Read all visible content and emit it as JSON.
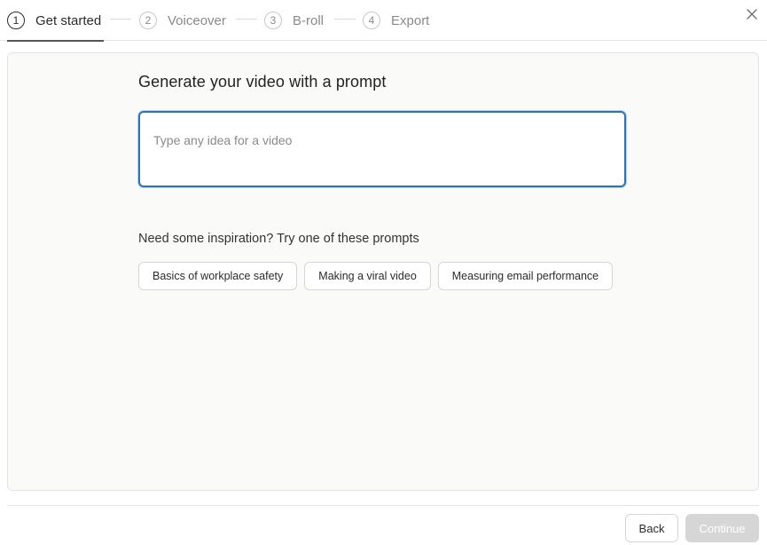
{
  "stepper": {
    "steps": [
      {
        "number": "1",
        "label": "Get started",
        "active": true
      },
      {
        "number": "2",
        "label": "Voiceover",
        "active": false
      },
      {
        "number": "3",
        "label": "B-roll",
        "active": false
      },
      {
        "number": "4",
        "label": "Export",
        "active": false
      }
    ],
    "close_icon": "close-icon"
  },
  "main": {
    "title": "Generate your video with a prompt",
    "prompt": {
      "value": "",
      "placeholder": "Type any idea for a video"
    },
    "inspiration_label": "Need some inspiration? Try one of these prompts",
    "suggestions": [
      "Basics of workplace safety",
      "Making a viral video",
      "Measuring email performance"
    ]
  },
  "footer": {
    "back_label": "Back",
    "continue_label": "Continue",
    "continue_enabled": false
  },
  "colors": {
    "accent": "#2e73b8",
    "disabled_button": "#d6d6d6",
    "panel_background": "#fafaf9"
  }
}
